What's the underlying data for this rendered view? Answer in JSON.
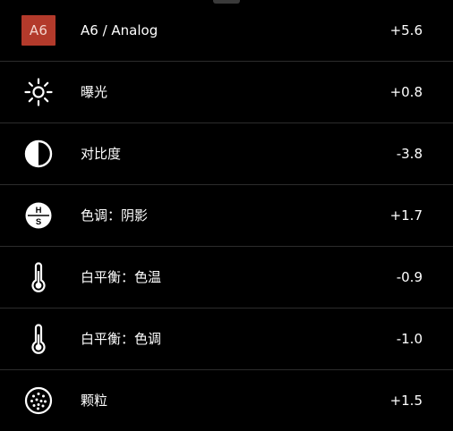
{
  "sheet": {
    "rows": [
      {
        "icon": "film-filter-badge",
        "badge": "A6",
        "label": "A6 / Analog",
        "value": "+5.6"
      },
      {
        "icon": "sun-icon",
        "label": "曝光",
        "value": "+0.8"
      },
      {
        "icon": "contrast-icon",
        "label": "对比度",
        "value": "-3.8"
      },
      {
        "icon": "highlight-shadow-icon",
        "glyph_top": "H",
        "glyph_bottom": "S",
        "label": "色调：阴影",
        "value": "+1.7"
      },
      {
        "icon": "thermometer-icon",
        "label": "白平衡：色温",
        "value": "-0.9"
      },
      {
        "icon": "thermometer-icon",
        "label": "白平衡：色调",
        "value": "-1.0"
      },
      {
        "icon": "grain-icon",
        "label": "颗粒",
        "value": "+1.5"
      }
    ]
  },
  "colors": {
    "background": "#000000",
    "text": "#ffffff",
    "badge": "#b33a2b",
    "divider": "#2c2c2c"
  }
}
